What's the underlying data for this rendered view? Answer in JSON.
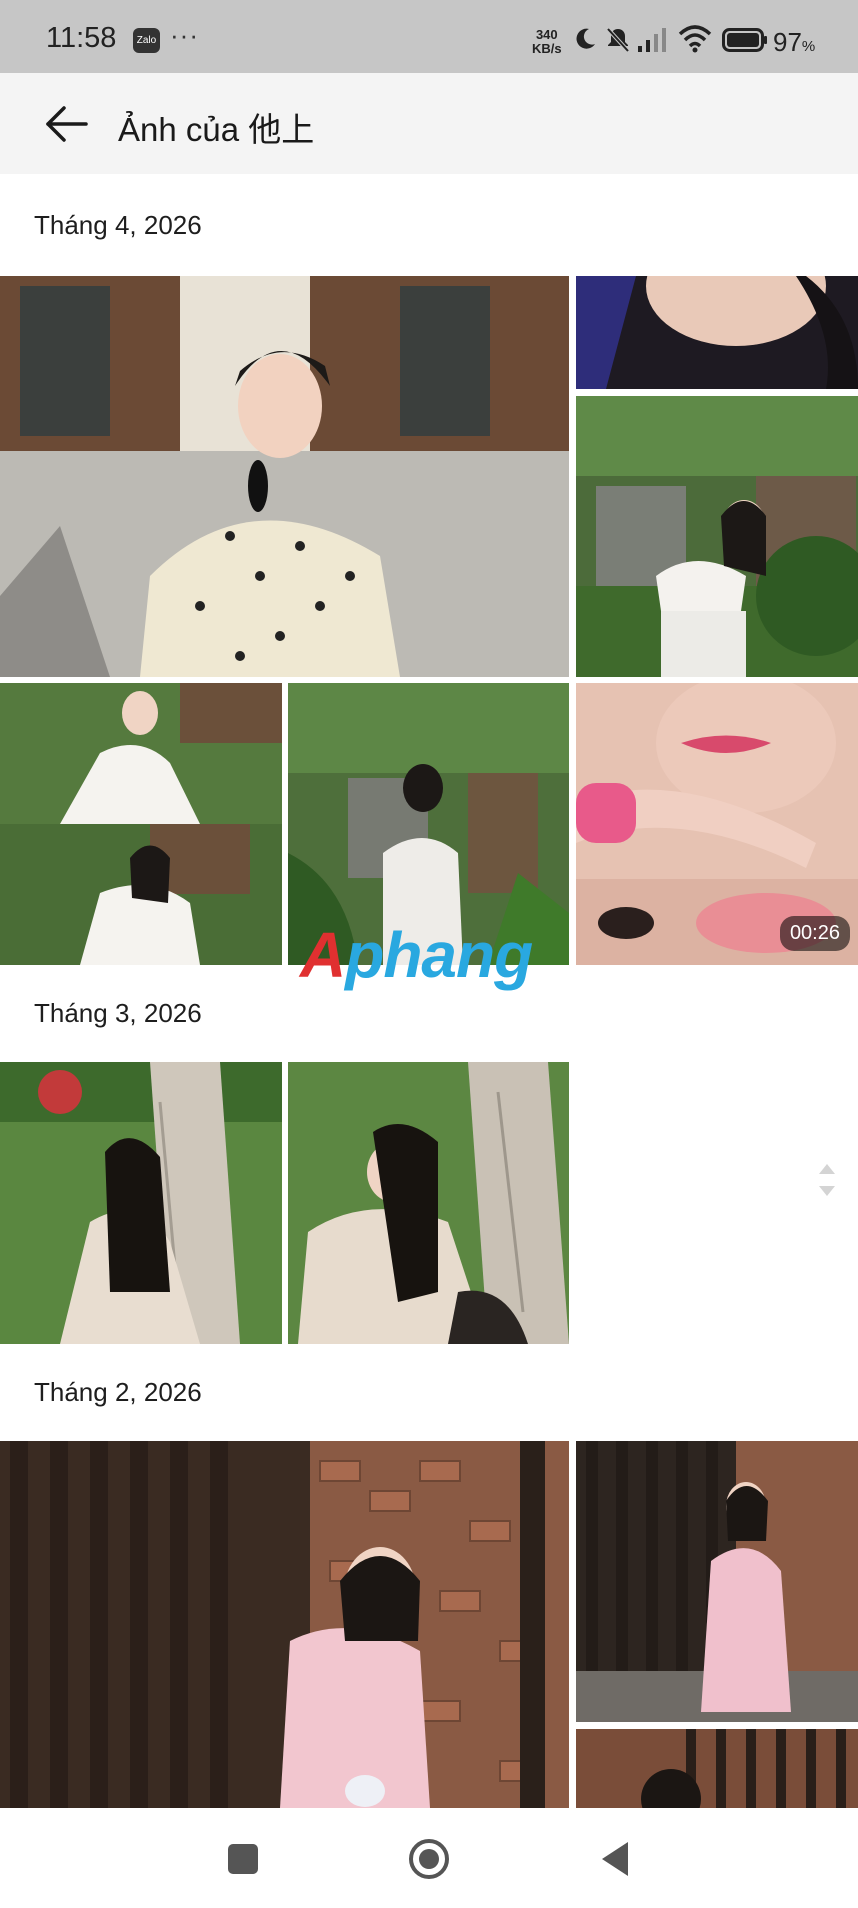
{
  "status_bar": {
    "time": "11:58",
    "app_badge": "Zalo",
    "more": "···",
    "net_speed_value": "340",
    "net_speed_unit": "KB/s",
    "battery_percent": "97",
    "battery_unit": "%"
  },
  "header": {
    "title": "Ảnh của 他上"
  },
  "sections": [
    {
      "label": "Tháng 4, 2026",
      "video_duration": "00:26"
    },
    {
      "label": "Tháng 3, 2026"
    },
    {
      "label": "Tháng 2, 2026"
    }
  ],
  "watermark": {
    "part1": "A",
    "part2": "phang"
  },
  "colors": {
    "statusbar_bg": "#c6c6c6",
    "appbar_bg": "#f4f4f4",
    "page_bg": "#ffffff"
  }
}
